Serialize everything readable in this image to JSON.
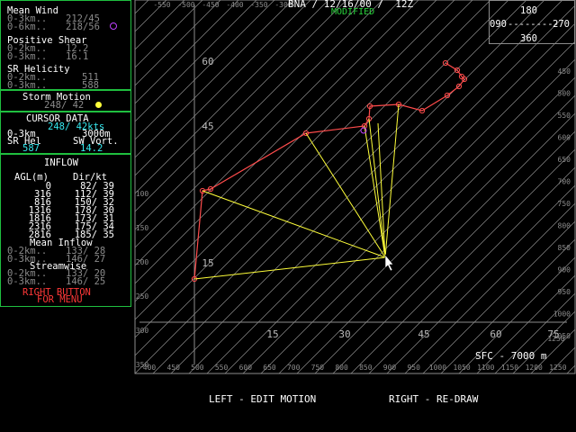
{
  "header": {
    "station": "BNA",
    "date": "12/16/00",
    "time": "12Z",
    "status": "MODIFIED"
  },
  "compass": {
    "n": "180",
    "e": "270",
    "w": "090",
    "s": "360",
    "dash": "---------"
  },
  "left_panel": {
    "mean_wind": {
      "title": "Mean Wind",
      "rows": [
        {
          "label": "0-3km..",
          "value": "212/45"
        },
        {
          "label": "0-6km..",
          "value": "218/56"
        }
      ]
    },
    "positive_shear": {
      "title": "Positive Shear",
      "rows": [
        {
          "label": "0-2km..",
          "value": "12.2"
        },
        {
          "label": "0-3km..",
          "value": "16.1"
        }
      ]
    },
    "sr_helicity": {
      "title": "SR Helicity",
      "rows": [
        {
          "label": "0-2km..",
          "value": "511"
        },
        {
          "label": "0-3km..",
          "value": "588"
        }
      ]
    },
    "storm_motion": {
      "title": "Storm Motion",
      "value": "248/ 42"
    },
    "cursor_data": {
      "title": "CURSOR DATA",
      "dirspd": "248/ 42kts",
      "layer_label": "0-3km",
      "layer_value": "3000m",
      "sr_hel_label": "SR Hel",
      "sw_vort_label": "SW Vort.",
      "sr_hel_value": "587",
      "sw_vort_value": "14.2"
    },
    "inflow": {
      "title": "INFLOW",
      "col1": "AGL(m)",
      "col2": "Dir/kt",
      "rows": [
        {
          "agl": "0",
          "dir": "82/ 39"
        },
        {
          "agl": "316",
          "dir": "112/ 39"
        },
        {
          "agl": "816",
          "dir": "150/ 32"
        },
        {
          "agl": "1316",
          "dir": "178/ 30"
        },
        {
          "agl": "1816",
          "dir": "173/ 31"
        },
        {
          "agl": "2316",
          "dir": "175/ 34"
        },
        {
          "agl": "2816",
          "dir": "185/ 35"
        }
      ],
      "mean_inflow_title": "Mean Inflow",
      "mean_inflow": [
        {
          "label": "0-2km..",
          "value": "133/ 28"
        },
        {
          "label": "0-3km..",
          "value": "146/ 27"
        }
      ],
      "streamwise_title": "Streamwise",
      "streamwise": [
        {
          "label": "0-2km..",
          "value": "133/ 20"
        },
        {
          "label": "0-3km..",
          "value": "146/ 25"
        }
      ]
    },
    "menu_hint": {
      "line1": "RIGHT BUTTON",
      "line2": "FOR MENU"
    }
  },
  "hodograph": {
    "x_ticks": [
      "15",
      "30",
      "45",
      "60",
      "75"
    ],
    "y_ticks": [
      "15",
      "45",
      "60"
    ],
    "top_axis": [
      "-550",
      "-500",
      "-450",
      "-400",
      "-350",
      "-300"
    ],
    "bottom_axis": [
      "400",
      "450",
      "500",
      "550",
      "600",
      "650",
      "700",
      "750",
      "800",
      "850",
      "900",
      "950",
      "1000",
      "1050",
      "1100",
      "1150",
      "1200",
      "1250"
    ],
    "right_axis": [
      "450",
      "500",
      "550",
      "600",
      "650",
      "700",
      "750",
      "800",
      "850",
      "900",
      "950",
      "1000",
      "1050"
    ],
    "left_axis": [
      "100",
      "150",
      "200",
      "250",
      "300",
      "350"
    ],
    "bottom_right_corner": "1250",
    "sfc_label": "SFC - 7000 m",
    "colors": {
      "trace": "#ff4c4c",
      "rays": "#ffff3a",
      "grid": "#8c8c8c",
      "panel_border": "#1fbf3f"
    }
  },
  "footer": {
    "left_key": "LEFT",
    "left_action": "- EDIT MOTION",
    "right_key": "RIGHT",
    "right_action": "- RE-DRAW"
  }
}
